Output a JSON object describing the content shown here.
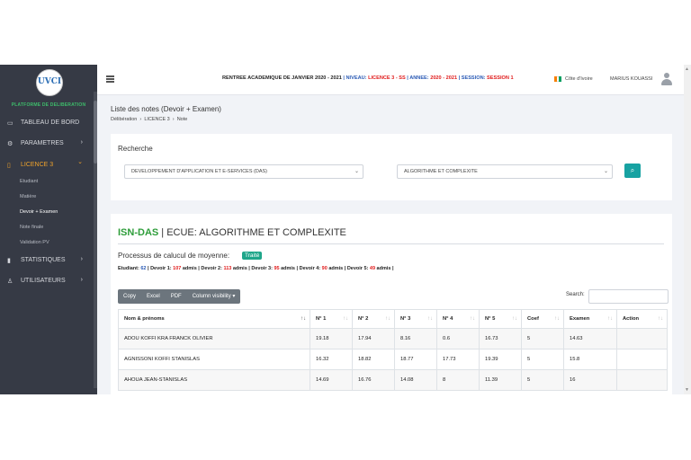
{
  "sidebar": {
    "logo_text": "UVCI",
    "platform": "PLATFORME DE DELIBERATION",
    "items": [
      {
        "icon": "monitor-icon",
        "glyph": "▭",
        "label": "TABLEAU DE BORD"
      },
      {
        "icon": "gear-icon",
        "glyph": "⚙",
        "label": "PARAMETRES",
        "chevron": "›"
      },
      {
        "icon": "file-icon",
        "glyph": "▯",
        "label": "LICENCE 3",
        "chevron": "⌄",
        "active": true
      },
      {
        "icon": "chart-icon",
        "glyph": "▮",
        "label": "STATISTIQUES",
        "chevron": "›"
      },
      {
        "icon": "user-icon",
        "glyph": "♙",
        "label": "UTILISATEURS",
        "chevron": "›"
      }
    ],
    "subitems": [
      "Etudiant",
      "Matière",
      "Devoir + Examen",
      "Note finale",
      "Validation PV"
    ],
    "current_sub": "Devoir + Examen"
  },
  "topbar": {
    "s1": "RENTREE ACADEMIQUE DE JANVIER 2020 - 2021",
    "s2": " | NIVEAU: ",
    "s3": "LICENCE 3 - SS",
    "s4": " | ANNEE: ",
    "s5": "2020 - 2021",
    "s6": " | SESSION: ",
    "s7": "SESSION 1",
    "country": "Côte d'Ivoire",
    "user": "MARIUS KOUASSI",
    "flag_colors": [
      "#f77f00",
      "#ffffff",
      "#009e60"
    ]
  },
  "page": {
    "title": "Liste des notes (Devoir + Examen)",
    "breadcrumb": [
      "Délibération",
      "LICENCE 3",
      "Note"
    ]
  },
  "search": {
    "heading": "Recherche",
    "filiere": "DEVELOPPEMENT D'APPLICATION ET E-SERVICES (DAS)",
    "ecue": "ALGORITHME ET COMPLEXITE",
    "button_icon": "search-icon"
  },
  "result": {
    "code": "ISN-DAS",
    "title": " | ECUE: ALGORITHME ET COMPLEXITE",
    "process_label": "Processus de calucul de moyenne:",
    "process_badge": "Traité",
    "stats": {
      "etudiant_label": "Etudiant: ",
      "etudiant": "62",
      "d1_label": " | Devoir 1: ",
      "d1": "107",
      "d1_suffix": " admis",
      "d2_label": " | Devoir 2: ",
      "d2": "113",
      "d2_suffix": " admis",
      "d3_label": " | Devoir 3: ",
      "d3": "95",
      "d3_suffix": " admis",
      "d4_label": " | Devoir 4: ",
      "d4": "90",
      "d4_suffix": " admis",
      "d5_label": " | Devoir 5: ",
      "d5": "49",
      "d5_suffix": " admis |"
    },
    "buttons": [
      "Copy",
      "Excel",
      "PDF",
      "Column visibility ▾"
    ],
    "search_label": "Search:",
    "columns": [
      "Nom & prénoms",
      "N° 1",
      "N° 2",
      "N° 3",
      "N° 4",
      "N° 5",
      "Coef",
      "Examen",
      "Action"
    ],
    "rows": [
      [
        "ADOU KOFFI KRA FRANCK OLIVIER",
        "19.18",
        "17.94",
        "8.16",
        "0.6",
        "16.73",
        "5",
        "14.63",
        ""
      ],
      [
        "AGNISSONI KOFFI STANISLAS",
        "16.32",
        "18.82",
        "18.77",
        "17.73",
        "19.39",
        "5",
        "15.8",
        ""
      ],
      [
        "AHOUA JEAN-STANISLAS",
        "14.69",
        "16.76",
        "14.08",
        "8",
        "11.39",
        "5",
        "16",
        ""
      ]
    ]
  }
}
